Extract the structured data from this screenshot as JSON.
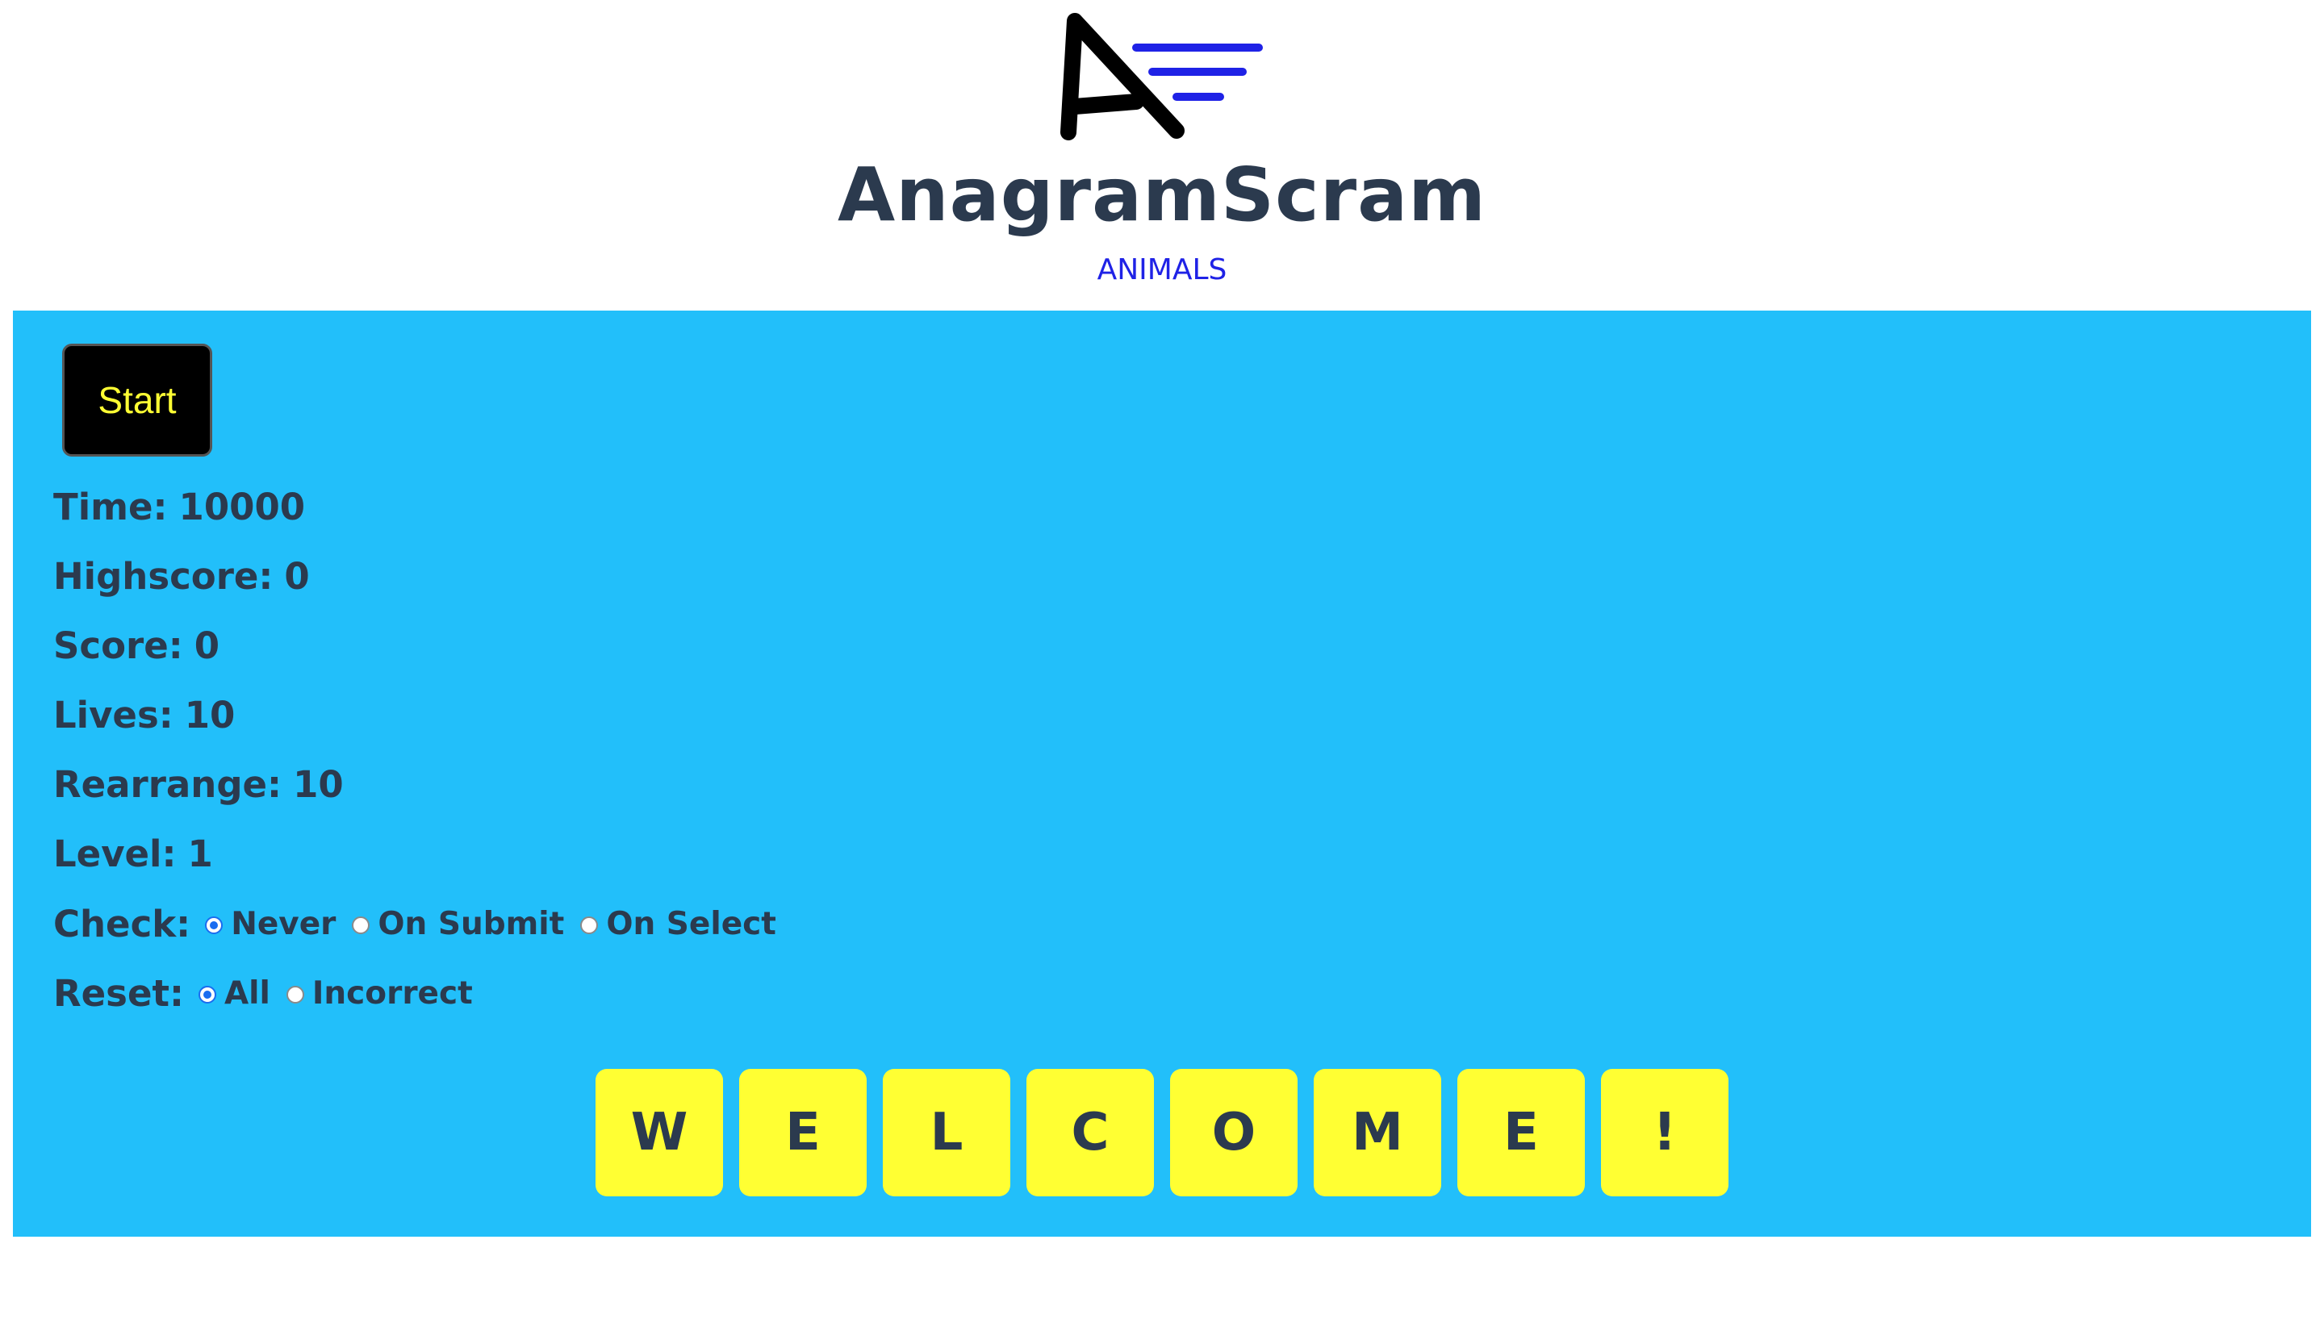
{
  "header": {
    "logo_icon": "anagramscram-logo-icon",
    "title": "AnagramScram",
    "subtitle": "ANIMALS",
    "logo_letter": "A",
    "logo_colors": {
      "letter": "#000000",
      "lines": "#1f22e6"
    }
  },
  "panel": {
    "background": "#22bffa",
    "start_label": "Start",
    "stats": {
      "time_label": "Time:",
      "time_value": "10000",
      "highscore_label": "Highscore:",
      "highscore_value": "0",
      "score_label": "Score:",
      "score_value": "0",
      "lives_label": "Lives:",
      "lives_value": "10",
      "rearrange_label": "Rearrange:",
      "rearrange_value": "10",
      "level_label": "Level:",
      "level_value": "1"
    },
    "check": {
      "label": "Check:",
      "options": [
        "Never",
        "On Submit",
        "On Select"
      ],
      "selected": "Never"
    },
    "reset": {
      "label": "Reset:",
      "options": [
        "All",
        "Incorrect"
      ],
      "selected": "All"
    },
    "tiles": [
      "W",
      "E",
      "L",
      "C",
      "O",
      "M",
      "E",
      "!"
    ],
    "tile_color": "#ffff33"
  }
}
